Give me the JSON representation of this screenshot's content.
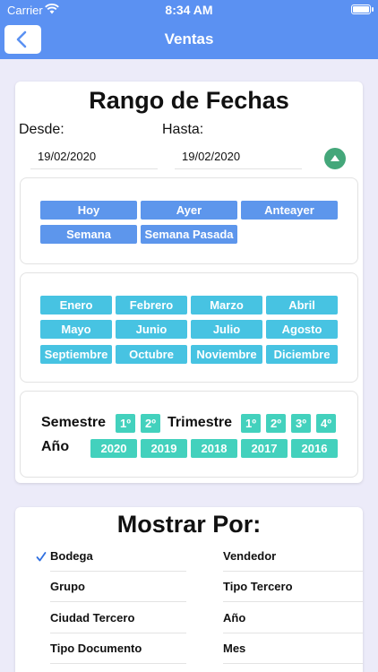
{
  "status_bar": {
    "carrier": "Carrier",
    "time": "8:34 AM"
  },
  "nav": {
    "title": "Ventas",
    "back_icon": "chevron-left-icon"
  },
  "rango": {
    "title": "Rango de Fechas",
    "desde_label": "Desde:",
    "hasta_label": "Hasta:",
    "desde_value": "19/02/2020",
    "hasta_value": "19/02/2020",
    "toggle_icon": "caret-up-icon",
    "quick": [
      "Hoy",
      "Ayer",
      "Anteayer",
      "Semana",
      "Semana Pasada"
    ],
    "months": [
      "Enero",
      "Febrero",
      "Marzo",
      "Abril",
      "Mayo",
      "Junio",
      "Julio",
      "Agosto",
      "Septiembre",
      "Octubre",
      "Noviembre",
      "Diciembre"
    ],
    "semestre_label": "Semestre",
    "semestres": [
      "1º",
      "2º"
    ],
    "trimestre_label": "Trimestre",
    "trimestres": [
      "1º",
      "2º",
      "3º",
      "4º"
    ],
    "anio_label": "Año",
    "anios": [
      "2020",
      "2019",
      "2018",
      "2017",
      "2016"
    ]
  },
  "mostrar": {
    "title": "Mostrar Por:",
    "left": [
      "Bodega",
      "Grupo",
      "Ciudad Tercero",
      "Tipo Documento"
    ],
    "right": [
      "Vendedor",
      "Tipo Tercero",
      "Año",
      "Mes"
    ],
    "selected": "Bodega"
  },
  "colors": {
    "primary": "#5b91f2",
    "chip_blue": "#5d96ec",
    "chip_cyan": "#47c3e2",
    "chip_teal": "#43d1bd",
    "toggle_green": "#44a77a",
    "check_blue": "#2f6fe0"
  }
}
